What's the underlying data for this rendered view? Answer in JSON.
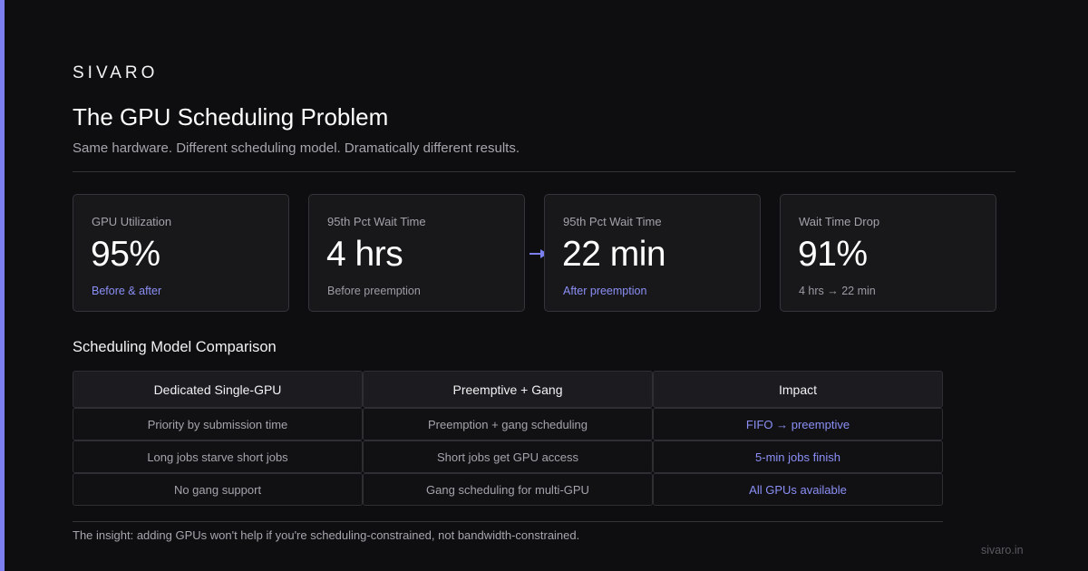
{
  "brand": "SIVARO",
  "title": "The GPU Scheduling Problem",
  "subtitle": "Same hardware. Different scheduling model. Dramatically different results.",
  "colors": {
    "background": "#0e0e10",
    "accent": "#7b7ff0",
    "accent_text": "#8b8ff5",
    "card": "#18181b"
  },
  "metrics": [
    {
      "label": "GPU Utilization",
      "value": "95%",
      "note": "Before & after",
      "note_accent": true
    },
    {
      "label": "95th Pct Wait Time",
      "value": "4 hrs",
      "note": "Before preemption",
      "note_accent": false
    },
    {
      "label": "95th Pct Wait Time",
      "value": "22 min",
      "note": "After preemption",
      "note_accent": true
    },
    {
      "label": "Wait Time Drop",
      "value": "91%",
      "note": "4 hrs → 22 min",
      "note_accent": false
    }
  ],
  "arrow_icon": "arrow-right-icon",
  "comparison": {
    "title": "Scheduling Model Comparison",
    "headers": [
      "Dedicated Single-GPU",
      "Preemptive + Gang",
      "Impact"
    ],
    "rows": [
      [
        "Priority by submission time",
        "Preemption + gang scheduling",
        "FIFO → preemptive"
      ],
      [
        "Long jobs starve short jobs",
        "Short jobs get GPU access",
        "5-min jobs finish"
      ],
      [
        "No gang support",
        "Gang scheduling for multi-GPU",
        "All GPUs available"
      ]
    ]
  },
  "insight": "The insight: adding GPUs won't help if you're scheduling-constrained, not bandwidth-constrained.",
  "footer": "sivaro.in"
}
